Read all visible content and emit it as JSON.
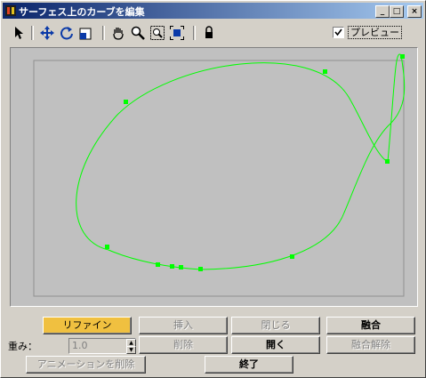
{
  "window": {
    "title": "サーフェス上のカーブを編集",
    "minimize_glyph": "_",
    "maximize_glyph": "□",
    "close_glyph": "×"
  },
  "toolbar": {
    "icons": [
      "select-arrow-icon",
      "move-icon",
      "rotate-icon",
      "scale-icon",
      "pan-hand-icon",
      "zoom-icon",
      "zoom-region-icon",
      "zoom-extents-icon",
      "lock-icon"
    ],
    "preview_label": "プレビュー",
    "preview_checked": true
  },
  "viewport": {
    "curve_color": "#00ff00",
    "background": "#c0c0c0"
  },
  "buttons": {
    "refine": "リファイン",
    "insert": "挿入",
    "close": "閉じる",
    "fuse": "融合",
    "delete": "削除",
    "open": "開く",
    "unfuse": "融合解除",
    "delete_animation": "アニメーションを削除",
    "done": "終了"
  },
  "weight": {
    "label": "重み：",
    "value": "1.0"
  },
  "colors": {
    "active_button": "#f0c040",
    "title_gradient_start": "#0a246a",
    "title_gradient_end": "#a6caf0"
  }
}
